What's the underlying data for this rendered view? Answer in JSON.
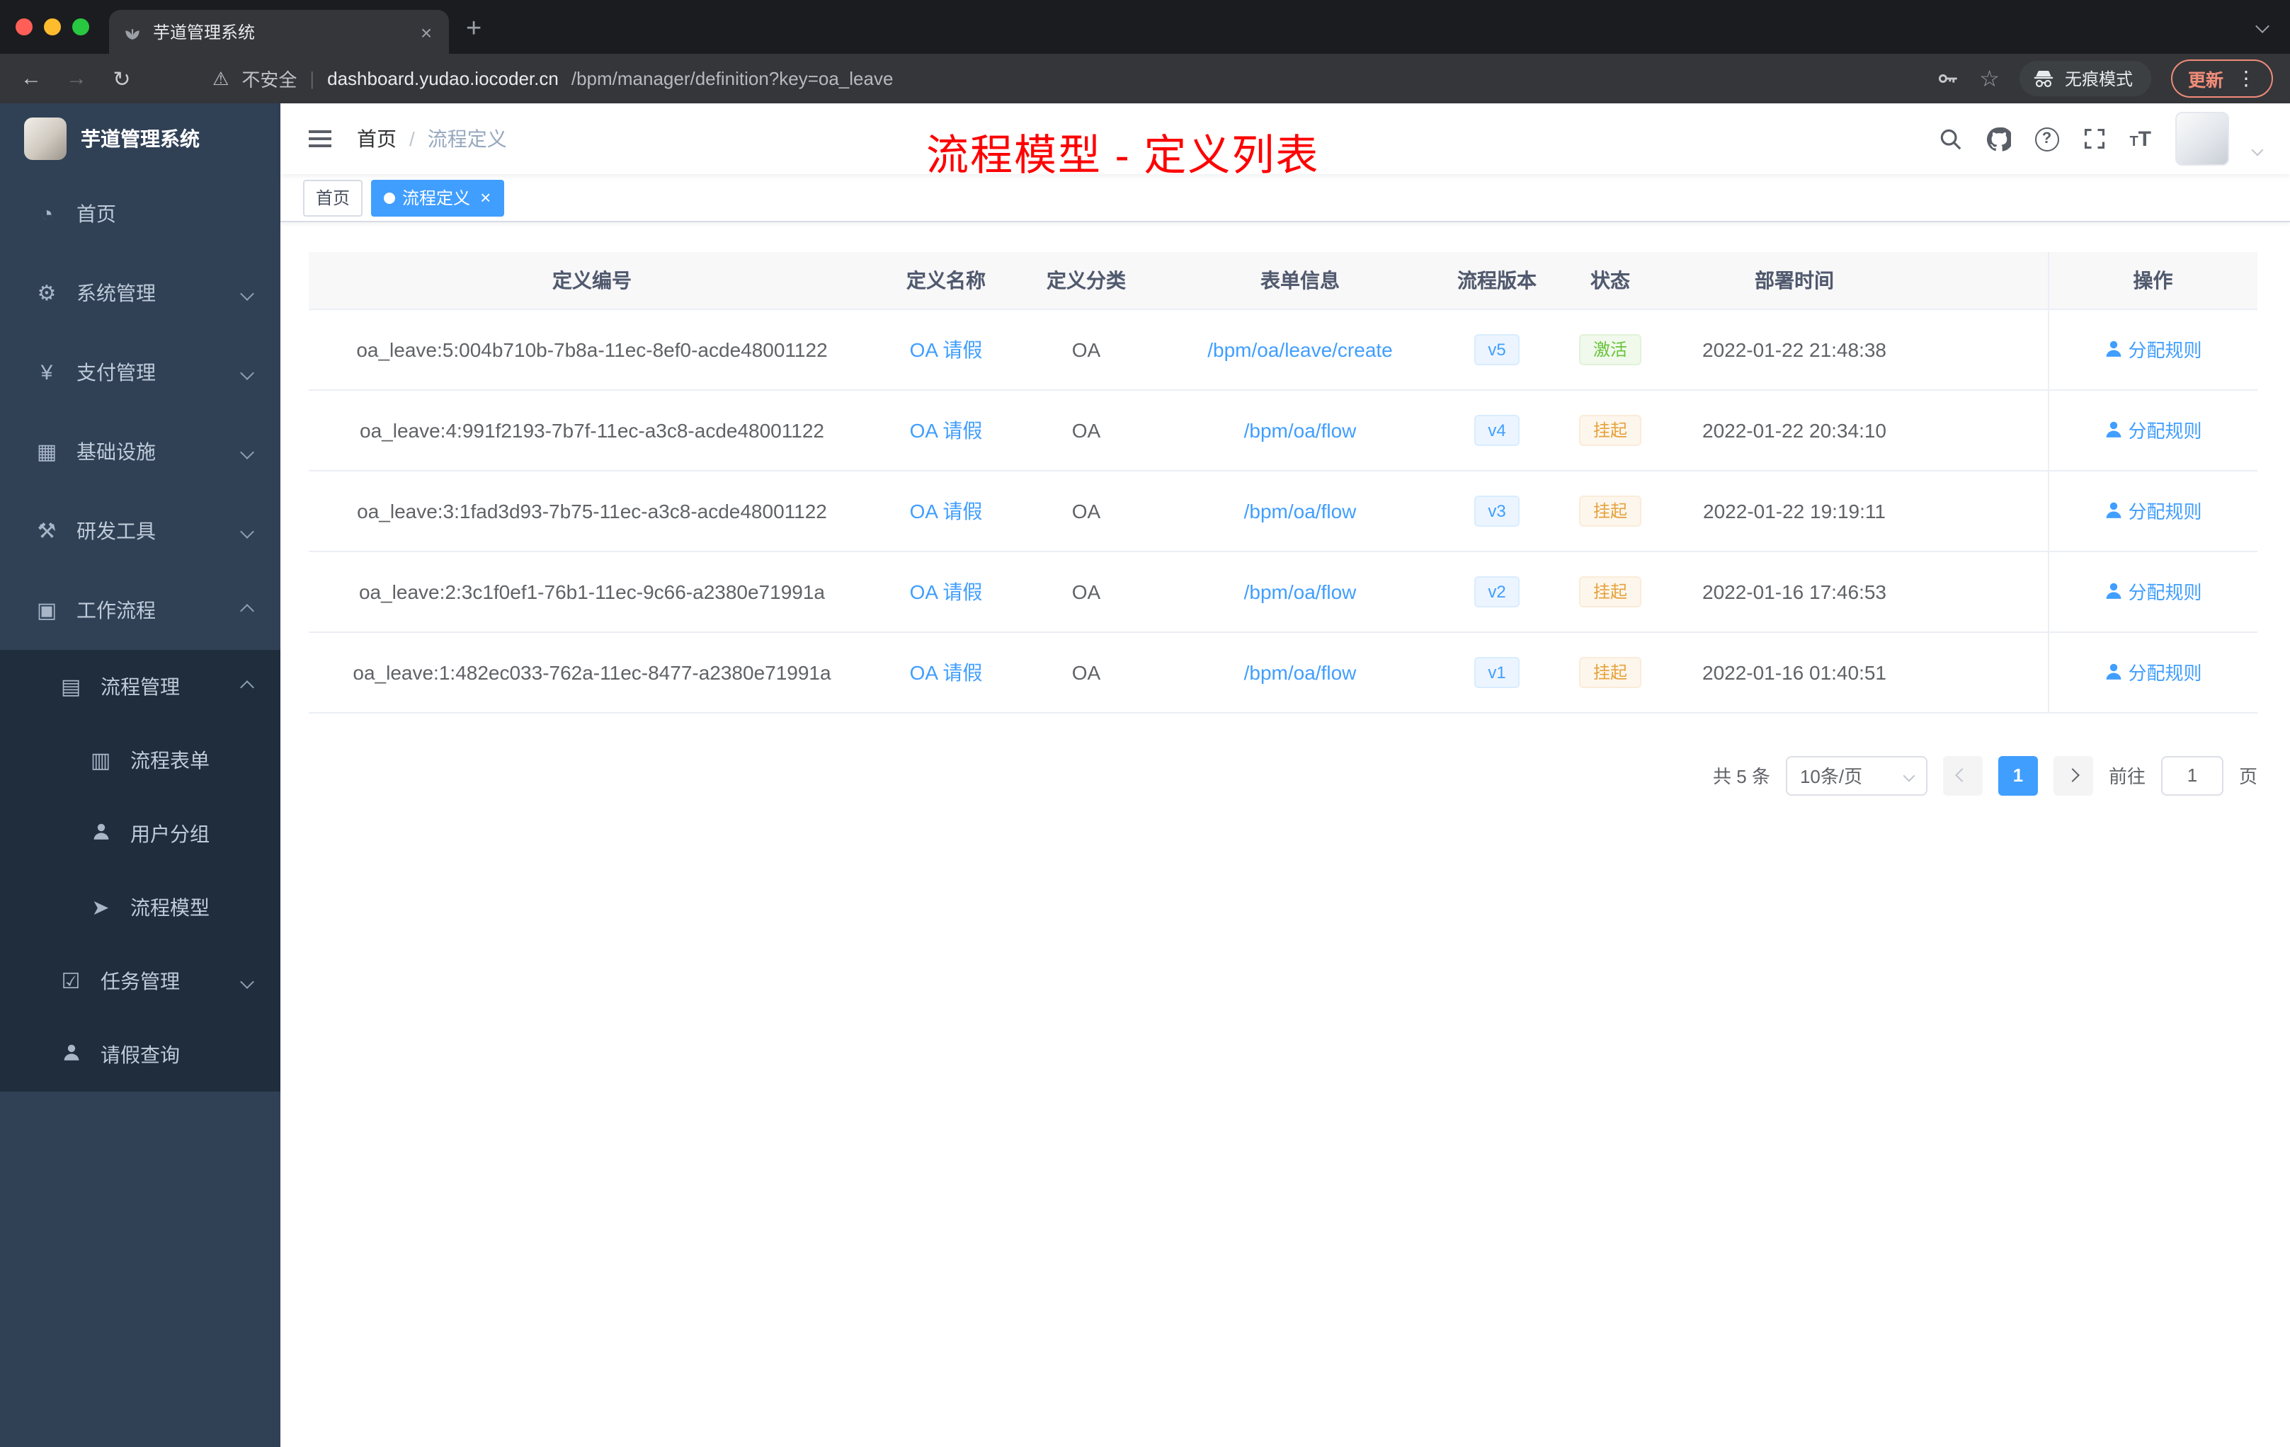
{
  "browser": {
    "tab_title": "芋道管理系统",
    "security_label": "不安全",
    "separator": "|",
    "url_domain": "dashboard.yudao.iocoder.cn",
    "url_path": "/bpm/manager/definition?key=oa_leave",
    "incognito_label": "无痕模式",
    "update_label": "更新"
  },
  "icons": {
    "close": "×",
    "new_tab": "+",
    "back": "←",
    "forward": "→",
    "reload": "↻",
    "warning": "⚠",
    "star": "☆",
    "kebab": "⋮",
    "dashboard": "◔",
    "gear": "⚙",
    "yen": "¥",
    "infra": "▦",
    "tools": "⚒",
    "workflow": "▣",
    "process_mgmt": "▤",
    "process_form": "▥",
    "process_model": "➤",
    "task": "☑",
    "question": "?",
    "font_small": "T",
    "font_big": "T"
  },
  "sidebar": {
    "brand": "芋道管理系统",
    "items": [
      {
        "label": "首页"
      },
      {
        "label": "系统管理"
      },
      {
        "label": "支付管理"
      },
      {
        "label": "基础设施"
      },
      {
        "label": "研发工具"
      },
      {
        "label": "工作流程"
      }
    ],
    "workflow": {
      "process_mgmt": "流程管理",
      "children": [
        {
          "label": "流程表单"
        },
        {
          "label": "用户分组"
        },
        {
          "label": "流程模型"
        }
      ],
      "task_mgmt": "任务管理",
      "leave_query": "请假查询"
    }
  },
  "navbar": {
    "breadcrumb_home": "首页",
    "breadcrumb_sep": "/",
    "breadcrumb_current": "流程定义"
  },
  "annotation": {
    "text": "流程模型 - 定义列表",
    "color": "#fe0000"
  },
  "tags": {
    "home": "首页",
    "current": "流程定义"
  },
  "table": {
    "columns": [
      "定义编号",
      "定义名称",
      "定义分类",
      "表单信息",
      "流程版本",
      "状态",
      "部署时间",
      "操作"
    ],
    "rows": [
      {
        "id": "oa_leave:5:004b710b-7b8a-11ec-8ef0-acde48001122",
        "name": "OA 请假",
        "category": "OA",
        "form": "/bpm/oa/leave/create",
        "version": "v5",
        "status": "激活",
        "status_type": "success",
        "time": "2022-01-22 21:48:38",
        "action": "分配规则"
      },
      {
        "id": "oa_leave:4:991f2193-7b7f-11ec-a3c8-acde48001122",
        "name": "OA 请假",
        "category": "OA",
        "form": "/bpm/oa/flow",
        "version": "v4",
        "status": "挂起",
        "status_type": "warning",
        "time": "2022-01-22 20:34:10",
        "action": "分配规则"
      },
      {
        "id": "oa_leave:3:1fad3d93-7b75-11ec-a3c8-acde48001122",
        "name": "OA 请假",
        "category": "OA",
        "form": "/bpm/oa/flow",
        "version": "v3",
        "status": "挂起",
        "status_type": "warning",
        "time": "2022-01-22 19:19:11",
        "action": "分配规则"
      },
      {
        "id": "oa_leave:2:3c1f0ef1-76b1-11ec-9c66-a2380e71991a",
        "name": "OA 请假",
        "category": "OA",
        "form": "/bpm/oa/flow",
        "version": "v2",
        "status": "挂起",
        "status_type": "warning",
        "time": "2022-01-16 17:46:53",
        "action": "分配规则"
      },
      {
        "id": "oa_leave:1:482ec033-762a-11ec-8477-a2380e71991a",
        "name": "OA 请假",
        "category": "OA",
        "form": "/bpm/oa/flow",
        "version": "v1",
        "status": "挂起",
        "status_type": "warning",
        "time": "2022-01-16 01:40:51",
        "action": "分配规则"
      }
    ]
  },
  "pagination": {
    "total": "共 5 条",
    "page_size": "10条/页",
    "current": "1",
    "goto_label": "前往",
    "goto_value": "1",
    "page_label": "页"
  },
  "colors": {
    "accent": "#409eff",
    "success": "#67c23a",
    "warning": "#e6a23c",
    "sidebar_bg": "#304156",
    "submenu_bg": "#1f2d3d",
    "annotation": "#fe0000"
  }
}
